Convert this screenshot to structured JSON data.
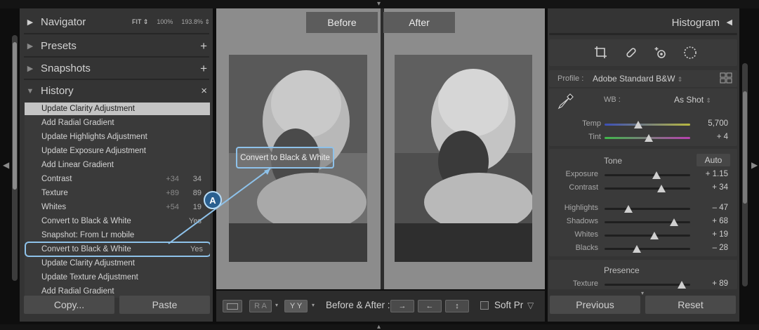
{
  "left_panel": {
    "navigator": {
      "title": "Navigator",
      "options": [
        "FIT",
        "100%",
        "193.8%"
      ]
    },
    "presets": {
      "title": "Presets",
      "action": "+"
    },
    "snapshots": {
      "title": "Snapshots",
      "action": "+"
    },
    "history": {
      "title": "History",
      "action": "×",
      "items": [
        {
          "label": "Update Clarity Adjustment",
          "from": "",
          "to": ""
        },
        {
          "label": "Add Radial Gradient",
          "from": "",
          "to": ""
        },
        {
          "label": "Update Highlights Adjustment",
          "from": "",
          "to": ""
        },
        {
          "label": "Update Exposure Adjustment",
          "from": "",
          "to": ""
        },
        {
          "label": "Add Linear Gradient",
          "from": "",
          "to": ""
        },
        {
          "label": "Contrast",
          "from": "+34",
          "to": "34"
        },
        {
          "label": "Texture",
          "from": "+89",
          "to": "89"
        },
        {
          "label": "Whites",
          "from": "+54",
          "to": "19"
        },
        {
          "label": "Convert to Black & White",
          "from": "",
          "to": "Yes"
        },
        {
          "label": "Snapshot: From Lr mobile",
          "from": "",
          "to": ""
        },
        {
          "label": "Convert to Black & White",
          "from": "",
          "to": "Yes"
        },
        {
          "label": "Update Clarity Adjustment",
          "from": "",
          "to": ""
        },
        {
          "label": "Update Texture Adjustment",
          "from": "",
          "to": ""
        },
        {
          "label": "Add Radial Gradient",
          "from": "",
          "to": ""
        }
      ]
    },
    "copy_label": "Copy...",
    "paste_label": "Paste"
  },
  "center": {
    "before_label": "Before",
    "after_label": "After",
    "callout_text": "Convert to Black & White",
    "callout_badge": "A"
  },
  "toolbar": {
    "ra_label": "R A",
    "yy_label": "Y Y",
    "before_after_label": "Before & After :",
    "soft_proof_label": "Soft Pr"
  },
  "right_panel": {
    "histogram_title": "Histogram",
    "profile_label": "Profile :",
    "profile_value": "Adobe Standard B&W",
    "wb_label": "WB :",
    "wb_value": "As Shot",
    "temp": {
      "label": "Temp",
      "value": "5,700",
      "position": 0.39
    },
    "tint": {
      "label": "Tint",
      "value": "+ 4",
      "position": 0.52
    },
    "tone_label": "Tone",
    "auto_label": "Auto",
    "tone_sliders": [
      {
        "label": "Exposure",
        "value": "+ 1.15",
        "position": 0.61
      },
      {
        "label": "Contrast",
        "value": "+ 34",
        "position": 0.66
      }
    ],
    "tone_sliders_2": [
      {
        "label": "Highlights",
        "value": "– 47",
        "position": 0.28
      },
      {
        "label": "Shadows",
        "value": "+ 68",
        "position": 0.81
      },
      {
        "label": "Whites",
        "value": "+ 19",
        "position": 0.58
      },
      {
        "label": "Blacks",
        "value": "– 28",
        "position": 0.38
      }
    ],
    "presence_label": "Presence",
    "texture": {
      "label": "Texture",
      "value": "+ 89",
      "position": 0.9
    },
    "previous_label": "Previous",
    "reset_label": "Reset"
  },
  "colors": {
    "accent_highlight": "#8ec2ea",
    "badge": "#2a5f8f",
    "panel": "#343434",
    "workspace": "#8c8c8c"
  }
}
